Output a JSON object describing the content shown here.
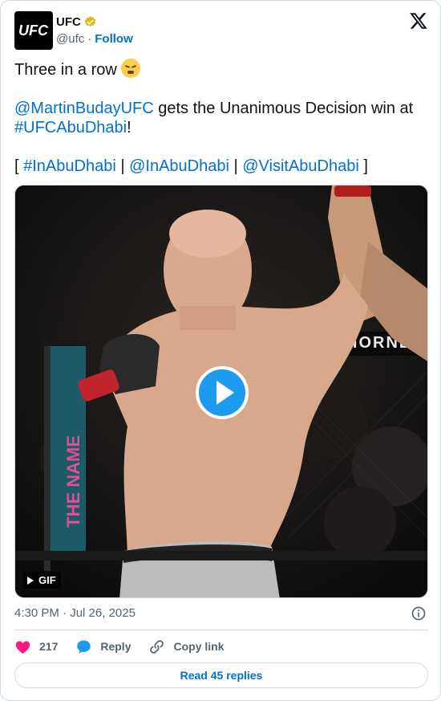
{
  "author": {
    "name": "UFC",
    "handle": "@ufc",
    "separator": "·",
    "follow_label": "Follow",
    "avatar_text": "UFC",
    "verified_color": "#e2b719"
  },
  "brand_icon": "x-logo-icon",
  "tweet": {
    "line1": "Three in a row",
    "emoji": "face-with-steam-from-nose",
    "mention1": "@MartinBudayUFC",
    "mid_text": " gets the Unanimous Decision win at ",
    "hashtag1": "#UFCAbuDhabi",
    "exclaim": "!",
    "bracket_open": "[ ",
    "tag2": "#InAbuDhabi",
    "pipe": " | ",
    "tag3": "@InAbuDhabi",
    "tag4": "@VisitAbuDhabi",
    "bracket_close": " ]"
  },
  "media": {
    "badge": "GIF",
    "play_icon": "play-icon",
    "scene_sign": "HORNE"
  },
  "meta": {
    "timestamp": "4:30 PM · Jul 26, 2025"
  },
  "actions": {
    "likes": "217",
    "reply_label": "Reply",
    "copy_label": "Copy link"
  },
  "read_replies": "Read 45 replies",
  "colors": {
    "link": "#006fd6",
    "muted": "#536471",
    "heart": "#f91880",
    "reply_bubble": "#1d9bf0",
    "border": "#cfd9de"
  }
}
